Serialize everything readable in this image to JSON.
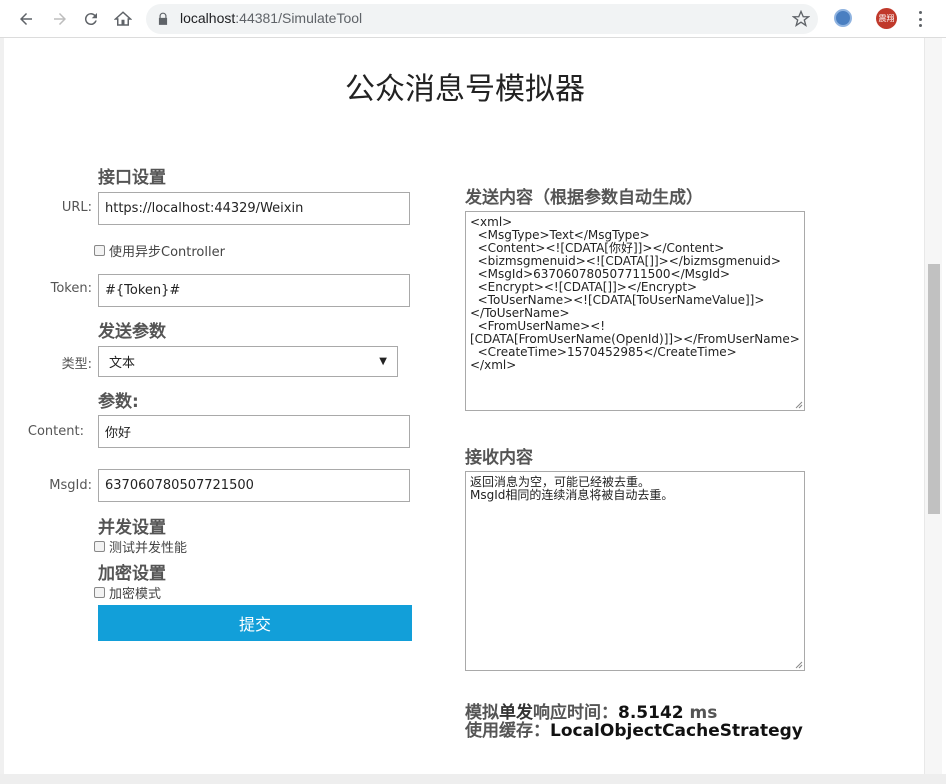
{
  "browser": {
    "url_host": "localhost",
    "url_port_path": ":44381/SimulateTool",
    "avatar_text": "震翔"
  },
  "page": {
    "title": "公众消息号模拟器"
  },
  "interface": {
    "heading": "接口设置",
    "url_label": "URL:",
    "url_value": "https://localhost:44329/Weixin",
    "async_label": "使用异步Controller",
    "token_label": "Token:",
    "token_value": "#{Token}#"
  },
  "send_params": {
    "heading": "发送参数",
    "type_label": "类型:",
    "type_value": "文本"
  },
  "params": {
    "heading": "参数:",
    "content_label": "Content:",
    "content_value": "你好",
    "msgid_label": "MsgId:",
    "msgid_value": "637060780507721500"
  },
  "concurrency": {
    "heading": "并发设置",
    "test_label": "测试并发性能"
  },
  "encryption": {
    "heading": "加密设置",
    "mode_label": "加密模式"
  },
  "submit_label": "提交",
  "send_content": {
    "heading": "发送内容（根据参数自动生成）",
    "xml": "<xml>\n  <MsgType>Text</MsgType>\n  <Content><![CDATA[你好]]></Content>\n  <bizmsgmenuid><![CDATA[]]></bizmsgmenuid>\n  <MsgId>637060780507711500</MsgId>\n  <Encrypt><![CDATA[]]></Encrypt>\n  <ToUserName><![CDATA[ToUserNameValue]]>\n</ToUserName>\n  <FromUserName><!\n[CDATA[FromUserName(OpenId)]]></FromUserName>\n  <CreateTime>1570452985</CreateTime>\n</xml>"
  },
  "receive_content": {
    "heading": "接收内容",
    "text": "返回消息为空，可能已经被去重。\nMsgId相同的连续消息将被自动去重。"
  },
  "stats": {
    "response_prefix": "模拟",
    "response_mid": "单发",
    "response_suffix": "响应时间：",
    "response_value": "8.5142",
    "response_unit": " ms",
    "cache_label": "使用缓存：",
    "cache_value": "LocalObjectCacheStrategy"
  }
}
